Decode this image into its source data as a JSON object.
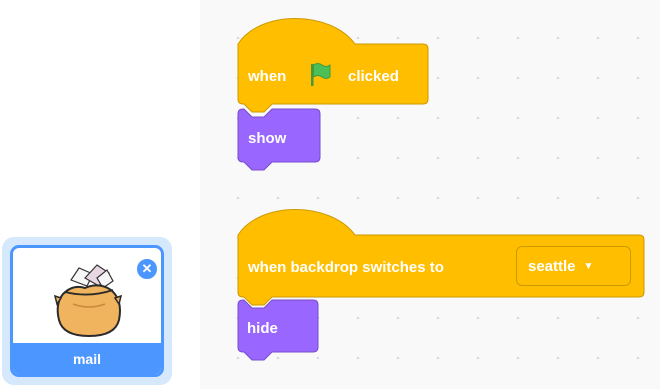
{
  "sprite": {
    "name": "mail",
    "delete_icon": "close-icon",
    "thumbnail_icon": "mail-bag-icon"
  },
  "scripts": [
    {
      "hat": {
        "prefix": "when",
        "icon": "green-flag-icon",
        "suffix": "clicked"
      },
      "next": {
        "label": "show"
      }
    },
    {
      "hat": {
        "prefix": "when backdrop switches to",
        "dropdown_value": "seattle",
        "dropdown_icon": "chevron-down-icon"
      },
      "next": {
        "label": "hide"
      }
    }
  ],
  "colors": {
    "events": "#ffbf00",
    "events_border": "#cc9900",
    "looks": "#9966ff",
    "looks_border": "#774dcb",
    "selection": "#4c97ff",
    "flag": "#4cbf56"
  }
}
